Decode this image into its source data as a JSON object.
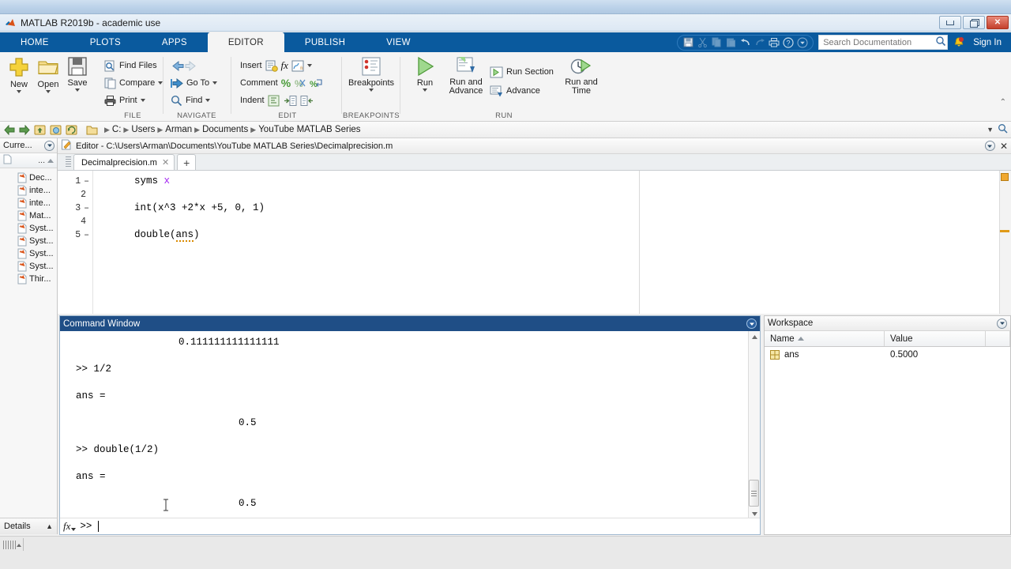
{
  "window": {
    "title": "MATLAB R2019b - academic use",
    "controls": {
      "minimize": "minimize-icon",
      "restore": "restore-icon",
      "close": "✕"
    }
  },
  "ribbon": {
    "tabs": [
      {
        "label": "HOME",
        "active": false
      },
      {
        "label": "PLOTS",
        "active": false
      },
      {
        "label": "APPS",
        "active": false
      },
      {
        "label": "EDITOR",
        "active": true
      },
      {
        "label": "PUBLISH",
        "active": false
      },
      {
        "label": "VIEW",
        "active": false
      }
    ],
    "quick_access": [
      "save-icon",
      "cut-icon",
      "copy-icon",
      "paste-icon",
      "undo-icon",
      "redo-icon",
      "print-icon",
      "help-icon",
      "customize-icon"
    ],
    "search": {
      "placeholder": "Search Documentation",
      "icon": "search-icon"
    },
    "notifications_icon": "bell-icon",
    "sign_in": "Sign In",
    "groups": [
      {
        "name": "FILE",
        "label": "FILE",
        "big_buttons": [
          {
            "label": "New",
            "icon": "new-file-icon",
            "has_dropdown": true
          },
          {
            "label": "Open",
            "icon": "open-folder-icon",
            "has_dropdown": true
          },
          {
            "label": "Save",
            "icon": "save-disk-icon",
            "has_dropdown": true
          }
        ],
        "small_buttons": [
          {
            "label": "Find Files",
            "icon": "find-files-icon",
            "has_dropdown": false
          },
          {
            "label": "Compare",
            "icon": "compare-icon",
            "has_dropdown": true
          },
          {
            "label": "Print",
            "icon": "printer-icon",
            "has_dropdown": true
          }
        ]
      },
      {
        "name": "NAVIGATE",
        "label": "NAVIGATE",
        "small_buttons": [
          {
            "label": "",
            "icon": "back-forward-icon",
            "has_dropdown": false
          },
          {
            "label": "Go To",
            "icon": "goto-icon",
            "has_dropdown": true
          },
          {
            "label": "Find",
            "icon": "find-magnifier-icon",
            "has_dropdown": true
          }
        ]
      },
      {
        "name": "EDIT",
        "label": "EDIT",
        "small_buttons": [
          {
            "label": "Insert",
            "icon": "insert-icon",
            "has_dropdown": true
          },
          {
            "label": "Comment",
            "icon": "comment-percent-icon",
            "has_dropdown": false
          },
          {
            "label": "Indent",
            "icon": "indent-icon",
            "has_dropdown": false
          }
        ]
      },
      {
        "name": "BREAKPOINTS",
        "label": "BREAKPOINTS",
        "big_buttons": [
          {
            "label": "Breakpoints",
            "icon": "breakpoints-icon",
            "has_dropdown": true
          }
        ]
      },
      {
        "name": "RUN",
        "label": "RUN",
        "big_buttons": [
          {
            "label": "Run",
            "icon": "run-play-icon",
            "has_dropdown": true
          },
          {
            "label": "Run and Advance",
            "icon": "run-advance-icon",
            "has_dropdown": false
          },
          {
            "label": "Run and Time",
            "icon": "run-time-icon",
            "has_dropdown": false
          }
        ],
        "small_buttons": [
          {
            "label": "Run Section",
            "icon": "run-section-icon",
            "has_dropdown": false
          },
          {
            "label": "Advance",
            "icon": "advance-icon",
            "has_dropdown": false
          }
        ]
      }
    ]
  },
  "pathbar": {
    "back_icon": "back-arrow-icon",
    "forward_icon": "forward-arrow-icon",
    "up_icon": "up-folder-icon",
    "browse_icon": "browse-folder-icon",
    "refresh_icon": "refresh-folder-icon",
    "folder_icon": "folder-icon",
    "crumbs": [
      "C:",
      "Users",
      "Arman",
      "Documents",
      "YouTube MATLAB Series"
    ],
    "dropdown_icon": "chevron-down-icon",
    "search_icon": "search-icon"
  },
  "current_folder": {
    "title": "Curre...",
    "collapse_icon": "panel-menu-icon",
    "column_header": "...",
    "sort_icon": "sort-asc-icon",
    "file_icon": "matlab-file-icon",
    "files": [
      "Dec...",
      "inte...",
      "inte...",
      "Mat...",
      "Syst...",
      "Syst...",
      "Syst...",
      "Syst...",
      "Thir..."
    ],
    "details_label": "Details",
    "details_chevron": "chevron-up-icon"
  },
  "editor": {
    "title": "Editor - C:\\Users\\Arman\\Documents\\YouTube MATLAB Series\\Decimalprecision.m",
    "title_icon": "editor-doc-icon",
    "panel_menu_icon": "panel-menu-icon",
    "close_icon": "close-icon",
    "tab": {
      "label": "Decimalprecision.m",
      "close": "✕"
    },
    "new_tab": "+",
    "lines": [
      {
        "num": "1",
        "marker": "–",
        "code": "syms ",
        "var": "x",
        "trail": ""
      },
      {
        "num": "2",
        "marker": "",
        "code": "",
        "var": "",
        "trail": ""
      },
      {
        "num": "3",
        "marker": "–",
        "code": "int(x^3 +2*x +5, 0, 1)",
        "var": "",
        "trail": ""
      },
      {
        "num": "4",
        "marker": "",
        "code": "",
        "var": "",
        "trail": ""
      },
      {
        "num": "5",
        "marker": "–",
        "code": "double(",
        "var": "",
        "trail": "ans",
        "after": ")"
      }
    ],
    "analyzer": {
      "warning_color": "#f0a830"
    }
  },
  "command_window": {
    "title": "Command Window",
    "panel_menu_icon": "panel-menu-icon",
    "lines": [
      {
        "text": "        0.111111111111111",
        "indent": 67
      },
      {
        "text": "",
        "indent": 0
      },
      {
        "text": ">> 1/2",
        "indent": 0
      },
      {
        "text": "",
        "indent": 0
      },
      {
        "text": "ans =",
        "indent": 0
      },
      {
        "text": "",
        "indent": 0
      },
      {
        "text": "    0.5",
        "indent": 152
      },
      {
        "text": "",
        "indent": 0
      },
      {
        "text": ">> double(1/2)",
        "indent": 0
      },
      {
        "text": "",
        "indent": 0
      },
      {
        "text": "ans =",
        "indent": 0
      },
      {
        "text": "",
        "indent": 0
      },
      {
        "text": "    0.5",
        "indent": 152
      }
    ],
    "prompt": ">>",
    "fx_icon": "fx-icon",
    "scroll_up_icon": "scroll-up-icon",
    "scroll_down_icon": "scroll-down-icon"
  },
  "workspace": {
    "title": "Workspace",
    "panel_menu_icon": "panel-menu-icon",
    "columns": [
      "Name",
      "Value",
      ""
    ],
    "sort_column": "Name",
    "rows": [
      {
        "name": "ans",
        "value": "0.5000",
        "icon": "matrix-var-icon"
      }
    ]
  },
  "colors": {
    "ribbon_blue": "#0a5a9e",
    "cmdwin_header": "#1f4e86",
    "accent_warning": "#f0a830",
    "syntax_variable": "#a020f0"
  }
}
